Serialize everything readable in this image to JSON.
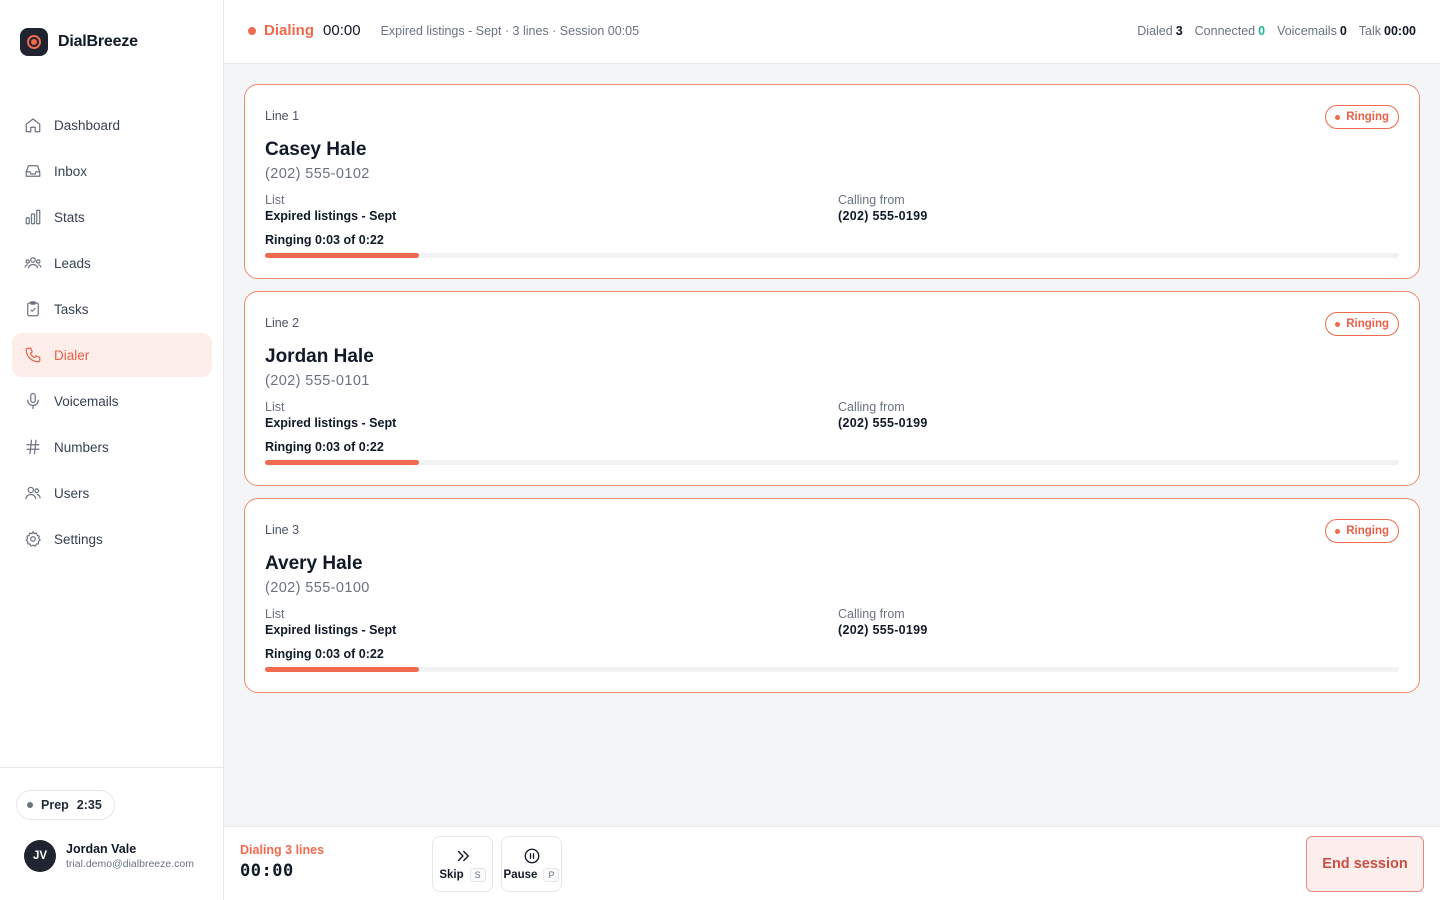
{
  "brand": {
    "name": "DialBreeze"
  },
  "sidebar": {
    "items": [
      {
        "label": "Dashboard",
        "icon": "home-icon"
      },
      {
        "label": "Inbox",
        "icon": "inbox-icon"
      },
      {
        "label": "Stats",
        "icon": "bar-chart-icon"
      },
      {
        "label": "Leads",
        "icon": "leads-icon"
      },
      {
        "label": "Tasks",
        "icon": "clipboard-icon"
      },
      {
        "label": "Dialer",
        "icon": "phone-icon",
        "active": true
      },
      {
        "label": "Voicemails",
        "icon": "microphone-icon"
      },
      {
        "label": "Numbers",
        "icon": "hash-icon"
      },
      {
        "label": "Users",
        "icon": "users-icon"
      },
      {
        "label": "Settings",
        "icon": "gear-icon"
      }
    ],
    "prep": {
      "label": "Prep",
      "time": "2:35"
    },
    "user": {
      "initials": "JV",
      "name": "Jordan Vale",
      "email": "trial.demo@dialbreeze.com"
    }
  },
  "topbar": {
    "status_label": "Dialing",
    "status_time": "00:00",
    "meta": "Expired listings - Sept · 3 lines · Session 00:05",
    "stats": {
      "dialed_label": "Dialed",
      "dialed_value": "3",
      "connected_label": "Connected",
      "connected_value": "0",
      "voicemails_label": "Voicemails",
      "voicemails_value": "0",
      "talk_label": "Talk",
      "talk_value": "00:00"
    }
  },
  "lines": [
    {
      "line": "Line 1",
      "status": "Ringing",
      "name": "Casey Hale",
      "phone": "(202) 555-0102",
      "list_label": "List",
      "list": "Expired listings - Sept",
      "from_label": "Calling from",
      "from": "(202) 555-0199",
      "ring_text": "Ringing 0:03 of 0:22",
      "progress": 0.136
    },
    {
      "line": "Line 2",
      "status": "Ringing",
      "name": "Jordan Hale",
      "phone": "(202) 555-0101",
      "list_label": "List",
      "list": "Expired listings - Sept",
      "from_label": "Calling from",
      "from": "(202) 555-0199",
      "ring_text": "Ringing 0:03 of 0:22",
      "progress": 0.136
    },
    {
      "line": "Line 3",
      "status": "Ringing",
      "name": "Avery Hale",
      "phone": "(202) 555-0100",
      "list_label": "List",
      "list": "Expired listings - Sept",
      "from_label": "Calling from",
      "from": "(202) 555-0199",
      "ring_text": "Ringing 0:03 of 0:22",
      "progress": 0.136
    }
  ],
  "bottombar": {
    "lines_text": "Dialing 3 lines",
    "timer": "00:00",
    "skip": {
      "label": "Skip",
      "key": "S"
    },
    "pause": {
      "label": "Pause",
      "key": "P"
    },
    "end_label": "End session"
  },
  "colors": {
    "accent": "#f06a4d",
    "connected": "#22b39a",
    "active_bg": "#fdeeea"
  }
}
